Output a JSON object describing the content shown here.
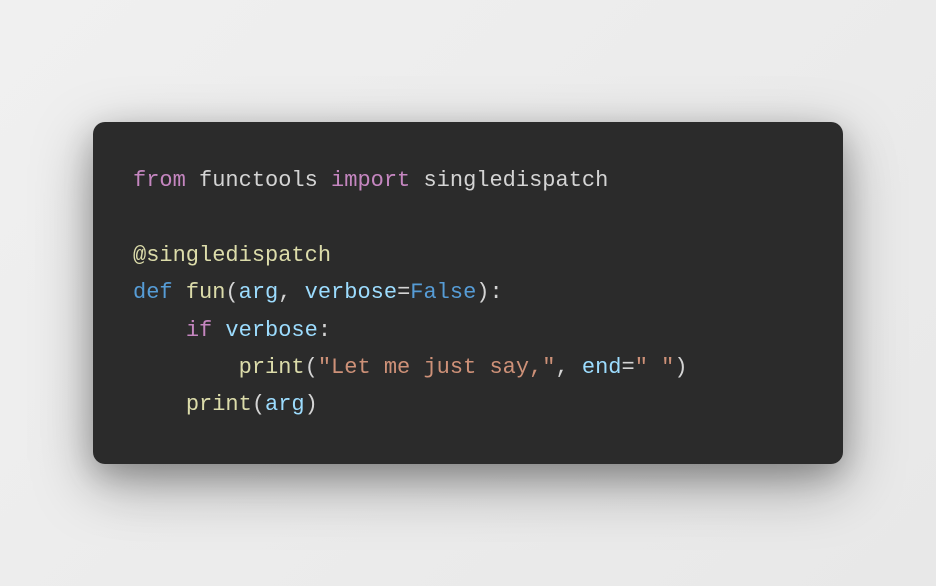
{
  "code": {
    "line1": {
      "from": "from",
      "module": "functools",
      "import": "import",
      "name": "singledispatch"
    },
    "line2": {
      "decorator": "@singledispatch"
    },
    "line3": {
      "def": "def",
      "func": "fun",
      "open": "(",
      "arg1": "arg",
      "comma": ", ",
      "arg2": "verbose",
      "eq": "=",
      "default": "False",
      "close": "):"
    },
    "line4": {
      "indent": "    ",
      "if": "if",
      "cond": "verbose",
      "colon": ":"
    },
    "line5": {
      "indent": "        ",
      "print": "print",
      "open": "(",
      "str": "\"Let me just say,\"",
      "comma": ", ",
      "kwarg": "end",
      "eq": "=",
      "val": "\" \"",
      "close": ")"
    },
    "line6": {
      "indent": "    ",
      "print": "print",
      "open": "(",
      "arg": "arg",
      "close": ")"
    }
  }
}
